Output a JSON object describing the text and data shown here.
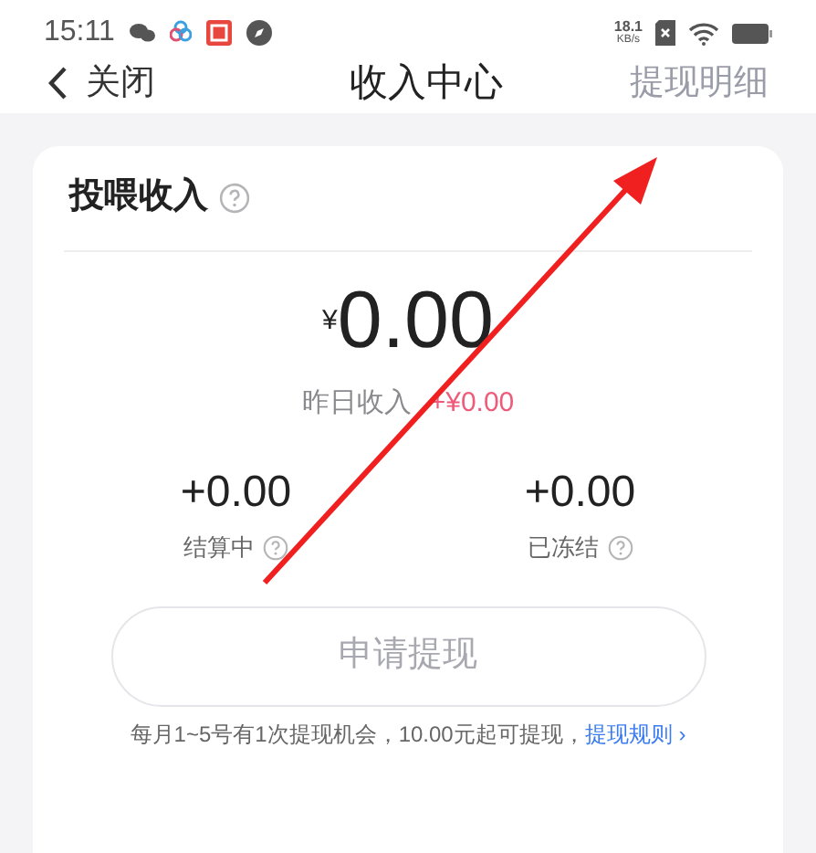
{
  "status_bar": {
    "time": "15:11",
    "net_speed": "18.1",
    "net_unit": "KB/s"
  },
  "nav": {
    "back": "关闭",
    "title": "收入中心",
    "action": "提现明细"
  },
  "card": {
    "title": "投喂收入",
    "currency": "¥",
    "amount": "0.00",
    "yesterday_label": "昨日收入",
    "yesterday_value": "+¥0.00",
    "stats": [
      {
        "value": "+0.00",
        "label": "结算中"
      },
      {
        "value": "+0.00",
        "label": "已冻结"
      }
    ],
    "button": {
      "label": "申请提现",
      "disabled": true
    },
    "note": "每月1~5号有1次提现机会，10.00元起可提现，",
    "rules_link": "提现规则 ›"
  }
}
